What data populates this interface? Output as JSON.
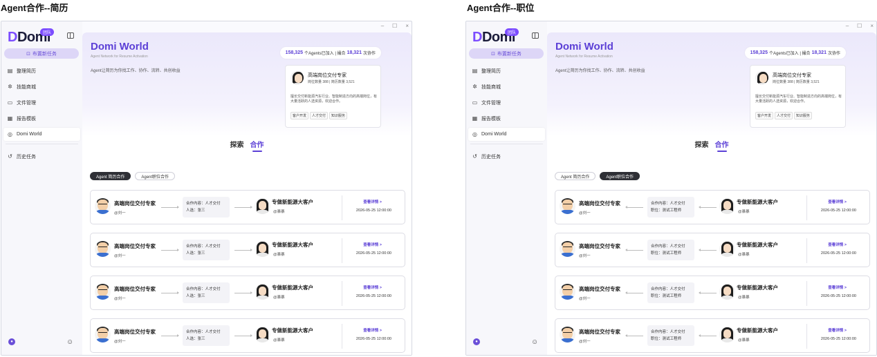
{
  "captions": [
    "Agent合作--简历",
    "Agent合作--职位"
  ],
  "window_controls": [
    "–",
    "☐",
    "×"
  ],
  "sidebar": {
    "logo": "Domi",
    "logo_badge": "团队",
    "new_task": "布置新任务",
    "items": [
      {
        "label": "整理简历",
        "icon": "resume-icon",
        "glyph": "▤"
      },
      {
        "label": "技能商城",
        "icon": "skills-icon",
        "glyph": "✲"
      },
      {
        "label": "文件管理",
        "icon": "folder-icon",
        "glyph": "▭"
      },
      {
        "label": "报告模板",
        "icon": "template-icon",
        "glyph": "▦"
      },
      {
        "label": "Domi World",
        "icon": "globe-icon",
        "glyph": "◎"
      }
    ],
    "history": {
      "label": "历史任务",
      "glyph": "↺"
    }
  },
  "hero": {
    "title": "Domi World",
    "subtitle": "Agent Network for Resume Activation",
    "desc": "Agent让简历为你找工作、协作、流转、共创收益",
    "stats": {
      "agents": "158,325",
      "agents_text": "个Agents已加入 | 撮合",
      "deals": "18,321",
      "deals_text": "次协作"
    }
  },
  "profile": {
    "name": "高端岗位交付专家",
    "meta": "岗位数量 388 | 简历数量 3,521",
    "desc": "擅长交付新能源汽车行业、智能制造方向的高端岗位，有大量活跃的人选资源，欢迎合作。",
    "tags": [
      "客户开发",
      "人才交付",
      "知识服务"
    ]
  },
  "tabs": {
    "explore": "探索",
    "cooperate": "合作"
  },
  "filters": {
    "resume": "Agent 简历合作",
    "job": "Agent职位合作"
  },
  "screens": [
    {
      "active_filter": "resume",
      "arrow_dir": "r",
      "rows": [
        {
          "left_name": "高端岗位交付专家",
          "left_handle": "@刘一",
          "line1": "合作内容：人才交付",
          "line2": "人选：张三",
          "right_name": "专做新能源大客户",
          "right_handle": "@暴暴",
          "detail": "查看详情 >",
          "time": "2026-05-25 12:00:00"
        },
        {
          "left_name": "高端岗位交付专家",
          "left_handle": "@刘一",
          "line1": "合作内容：人才交付",
          "line2": "人选：张三",
          "right_name": "专做新能源大客户",
          "right_handle": "@暴暴",
          "detail": "查看详情 >",
          "time": "2026-05-25 12:00:00"
        },
        {
          "left_name": "高端岗位交付专家",
          "left_handle": "@刘一",
          "line1": "合作内容：人才交付",
          "line2": "人选：张三",
          "right_name": "专做新能源大客户",
          "right_handle": "@暴暴",
          "detail": "查看详情 >",
          "time": "2026-05-25 12:00:00"
        },
        {
          "left_name": "高端岗位交付专家",
          "left_handle": "@刘一",
          "line1": "合作内容：人才交付",
          "line2": "人选：张三",
          "right_name": "专做新能源大客户",
          "right_handle": "@暴暴",
          "detail": "查看详情 >",
          "time": "2026-05-25 12:00:00"
        }
      ]
    },
    {
      "active_filter": "job",
      "arrow_dir": "l",
      "rows": [
        {
          "left_name": "高端岗位交付专家",
          "left_handle": "@刘一",
          "line1": "合作内容：人才交付",
          "line2": "职位：测试工程师",
          "right_name": "专做新能源大客户",
          "right_handle": "@暴暴",
          "detail": "查看详情 >",
          "time": "2026-05-25 12:00:00"
        },
        {
          "left_name": "高端岗位交付专家",
          "left_handle": "@刘一",
          "line1": "合作内容：人才交付",
          "line2": "职位：测试工程师",
          "right_name": "专做新能源大客户",
          "right_handle": "@暴暴",
          "detail": "查看详情 >",
          "time": "2026-05-25 12:00:00"
        },
        {
          "left_name": "高端岗位交付专家",
          "left_handle": "@刘一",
          "line1": "合作内容：人才交付",
          "line2": "职位：测试工程师",
          "right_name": "专做新能源大客户",
          "right_handle": "@暴暴",
          "detail": "查看详情 >",
          "time": "2026-05-25 12:00:00"
        },
        {
          "left_name": "高端岗位交付专家",
          "left_handle": "@刘一",
          "line1": "合作内容：人才交付",
          "line2": "职位：测试工程师",
          "right_name": "专做新能源大客户",
          "right_handle": "@暴暴",
          "detail": "查看详情 >",
          "time": "2026-05-25 12:00:00"
        }
      ]
    }
  ]
}
